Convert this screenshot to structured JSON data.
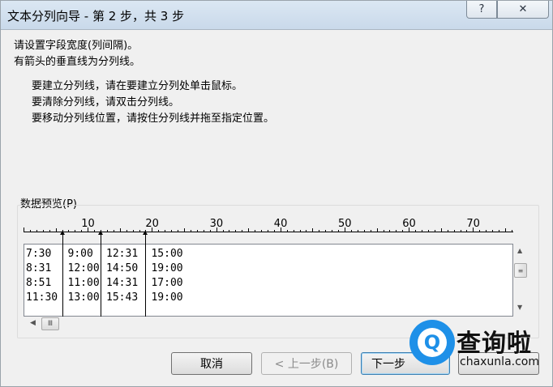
{
  "window": {
    "title": "文本分列向导 - 第 2 步，共 3 步",
    "help_glyph": "?",
    "close_glyph": "✕"
  },
  "instructions": {
    "line1": "请设置字段宽度(列间隔)。",
    "line2": "有箭头的垂直线为分列线。",
    "line3": "要建立分列线，请在要建立分列处单击鼠标。",
    "line4": "要清除分列线，请双击分列线。",
    "line5": "要移动分列线位置，请按住分列线并拖至指定位置。"
  },
  "preview": {
    "label": "数据预览(P)",
    "ruler_labels": [
      "10",
      "20",
      "30",
      "40",
      "50",
      "60",
      "70"
    ],
    "column_breaks": [
      6,
      12,
      19
    ],
    "rows": [
      [
        "7:30",
        "9:00",
        "12:31",
        "15:00"
      ],
      [
        "8:31",
        "12:00",
        "14:50",
        "19:00"
      ],
      [
        "8:51",
        "11:00",
        "14:31",
        "17:00"
      ],
      [
        "11:30",
        "13:00",
        "15:43",
        "19:00"
      ]
    ]
  },
  "buttons": {
    "cancel": "取消",
    "back": "< 上一步(B)",
    "next": "下一步",
    "finish": "完成"
  },
  "watermark": {
    "brand": "查询啦",
    "url": "chaxunla.com",
    "icon_letter": "Q"
  }
}
